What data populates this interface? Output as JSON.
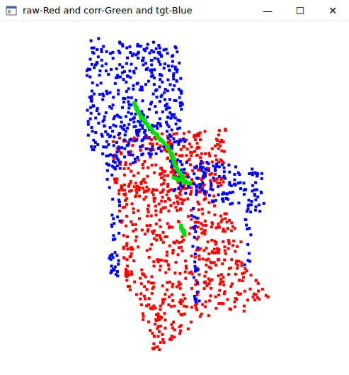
{
  "window": {
    "title": "raw-Red and corr-Green and tgt-Blue",
    "buttons": [
      "—",
      "☐",
      "✕"
    ]
  },
  "plot": {
    "series": [
      {
        "name": "raw",
        "color": "#ff0000",
        "size": 4,
        "regions": [
          {
            "polygon": [
              [
                160,
                195
              ],
              [
                320,
                180
              ],
              [
                318,
                262
              ],
              [
                240,
                290
              ],
              [
                162,
                272
              ]
            ],
            "count": 290
          },
          {
            "polygon": [
              [
                165,
                262
              ],
              [
                300,
                272
              ],
              [
                330,
                315
              ],
              [
                368,
                400
              ],
              [
                382,
                418
              ],
              [
                332,
                446
              ],
              [
                282,
                452
              ],
              [
                230,
                495
              ],
              [
                215,
                478
              ],
              [
                178,
                400
              ]
            ],
            "count": 470
          },
          {
            "polygon": [
              [
                176,
                345
              ],
              [
                190,
                345
              ],
              [
                188,
                410
              ],
              [
                178,
                410
              ]
            ],
            "count": 14
          },
          {
            "polygon": [
              [
                214,
                440
              ],
              [
                228,
                440
              ],
              [
                226,
                500
              ],
              [
                216,
                500
              ]
            ],
            "count": 14
          },
          {
            "polygon": [
              [
                300,
                300
              ],
              [
                318,
                300
              ],
              [
                312,
                420
              ],
              [
                302,
                420
              ]
            ],
            "count": 18
          }
        ]
      },
      {
        "name": "tgt",
        "color": "#0000ff",
        "size": 4,
        "regions": [
          {
            "polygon": [
              [
                118,
                52
              ],
              [
                252,
                62
              ],
              [
                262,
                200
              ],
              [
                240,
                212
              ],
              [
                165,
                240
              ],
              [
                125,
                215
              ]
            ],
            "count": 430
          },
          {
            "polygon": [
              [
                240,
                220
              ],
              [
                370,
                240
              ],
              [
                375,
                300
              ],
              [
                300,
                285
              ],
              [
                245,
                272
              ]
            ],
            "count": 150
          },
          {
            "polygon": [
              [
                148,
                215
              ],
              [
                172,
                215
              ],
              [
                168,
                395
              ],
              [
                155,
                395
              ]
            ],
            "count": 45
          },
          {
            "polygon": [
              [
                344,
                282
              ],
              [
                356,
                282
              ],
              [
                353,
                385
              ],
              [
                345,
                385
              ]
            ],
            "count": 16
          },
          {
            "polygon": [
              [
                270,
                290
              ],
              [
                280,
                290
              ],
              [
                282,
                440
              ],
              [
                275,
                440
              ]
            ],
            "count": 26
          }
        ]
      },
      {
        "name": "corr",
        "color": "#00e000",
        "size": 5,
        "lines": [
          {
            "polyline": [
              [
                188,
                145
              ],
              [
                200,
                165
              ],
              [
                215,
                185
              ],
              [
                232,
                202
              ],
              [
                242,
                215
              ],
              [
                250,
                238
              ],
              [
                258,
                250
              ],
              [
                264,
                258
              ]
            ],
            "count": 70
          },
          {
            "polyline": [
              [
                245,
                252
              ],
              [
                268,
                258
              ]
            ],
            "count": 10
          },
          {
            "polyline": [
              [
                255,
                318
              ],
              [
                258,
                325
              ],
              [
                262,
                332
              ]
            ],
            "count": 10
          }
        ]
      }
    ]
  }
}
